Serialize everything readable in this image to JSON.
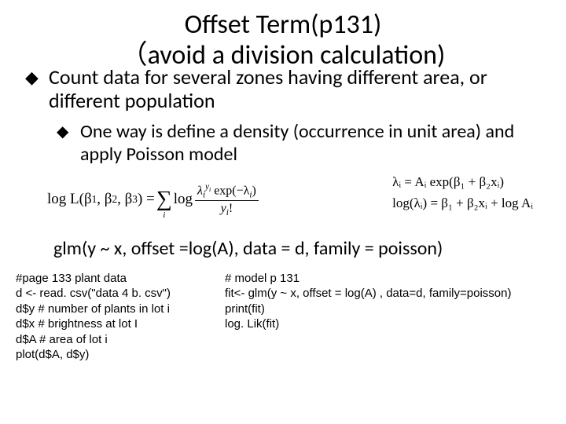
{
  "title_line1": "Offset Term(p131)",
  "title_line2": "（avoid a division calculation)",
  "bullet1": "Count data for several zones having different area, or different population",
  "bullet2": "One way is define a density (occurrence in unit area) and apply Poisson model",
  "formula_left_prefix": "log L(β",
  "formula_left_sub1": "1",
  "formula_left_mid1": ", β",
  "formula_left_sub2": "2",
  "formula_left_mid2": ", β",
  "formula_left_sub3": "3",
  "formula_left_mid3": ") = ",
  "formula_left_log": " log ",
  "frac_num_pre": "λ",
  "frac_num_sub": "i",
  "frac_num_sup_pre": "y",
  "frac_num_sup_sub": "i",
  "frac_num_exp": " exp(−λ",
  "frac_num_exp_sub": "i",
  "frac_num_close": ")",
  "frac_den_pre": "y",
  "frac_den_sub": "i",
  "frac_den_fact": "!",
  "formula_r1": "λᵢ = Aᵢ exp(β₁ + β₂xᵢ)",
  "formula_r2": "log(λᵢ) = β₁ + β₂xᵢ + log Aᵢ",
  "glm_line": "glm(y  ~ x, offset =log(A), data = d, family = poisson)",
  "code_left": [
    "#page 133 plant data",
    "d <- read. csv(\"data 4 b. csv\")",
    "d$y  # number of plants in lot i",
    "d$x  # brightness at lot I",
    "d$A  # area of lot i",
    "plot(d$A, d$y)"
  ],
  "code_right": [
    "# model p 131",
    "fit<- glm(y ~ x, offset = log(A) , data=d, family=poisson)",
    "print(fit)",
    "log. Lik(fit)"
  ]
}
